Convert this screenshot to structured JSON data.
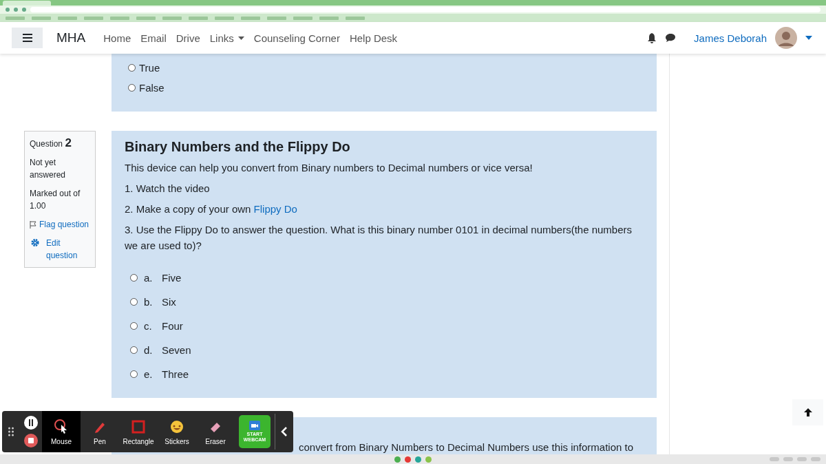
{
  "nav": {
    "brand": "MHA",
    "links": [
      {
        "label": "Home",
        "kind": "link"
      },
      {
        "label": "Email",
        "kind": "link"
      },
      {
        "label": "Drive",
        "kind": "link"
      },
      {
        "label": "Links",
        "kind": "dropdown"
      },
      {
        "label": "Counseling Corner",
        "kind": "link"
      },
      {
        "label": "Help Desk",
        "kind": "link"
      }
    ],
    "user": "James Deborah"
  },
  "previous_question": {
    "options": [
      {
        "label": "True",
        "selected": false
      },
      {
        "label": "False",
        "selected": false
      }
    ]
  },
  "question": {
    "number_label": "Question",
    "number": "2",
    "status": "Not yet answered",
    "marks": "Marked out of 1.00",
    "flag": "Flag question",
    "edit": "Edit question",
    "title": "Binary Numbers and the Flippy Do",
    "intro": "This device can help you convert from Binary numbers to Decimal numbers or vice versa!",
    "step_1": "1. Watch the video",
    "step_2": "2. Make a copy of your own",
    "link": "Flippy Do",
    "step_3": "3. Use the Flippy Do to answer the question. What is this binary number  0101 in decimal numbers(the numbers we are used to)?",
    "options": [
      {
        "letter": "a.",
        "label": "Five",
        "selected": false
      },
      {
        "letter": "b.",
        "label": "Six",
        "selected": false
      },
      {
        "letter": "c.",
        "label": "Four",
        "selected": false
      },
      {
        "letter": "d.",
        "label": "Seven",
        "selected": false
      },
      {
        "letter": "e.",
        "label": "Three",
        "selected": false
      }
    ]
  },
  "next_card": {
    "text": "convert from Binary Numbers to Decimal Numbers use this information to"
  },
  "toolbar": {
    "tools": [
      {
        "label": "Mouse",
        "kind": "mouse",
        "selected": true
      },
      {
        "label": "Pen",
        "kind": "pen",
        "selected": false
      },
      {
        "label": "Rectangle",
        "kind": "rectangle",
        "selected": false
      },
      {
        "label": "Stickers",
        "kind": "stickers",
        "selected": false
      },
      {
        "label": "Eraser",
        "kind": "eraser",
        "selected": false
      }
    ],
    "webcam": "START WEBCAM"
  }
}
